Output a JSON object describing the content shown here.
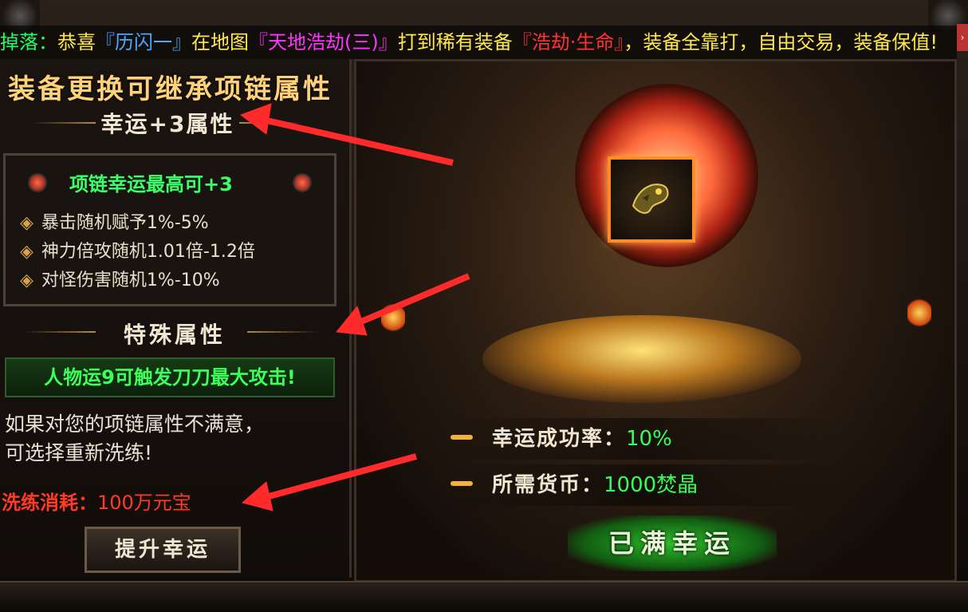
{
  "ticker": {
    "prefix": "掉落：",
    "congrats": "恭喜",
    "player": "『历闪一』",
    "at_map": "在地图",
    "map": "『天地浩劫(三)』",
    "got": "打到稀有装备",
    "item": "『浩劫·生命』",
    "suffix": "，装备全靠打，自由交易，装备保值!"
  },
  "left": {
    "headline": "装备更换可继承项链属性",
    "luck_title": "幸运+3属性",
    "box_title": "项链幸运最高可+3",
    "attributes": [
      "暴击随机赋予1%-5%",
      "神力倍攻随机1.01倍-1.2倍",
      "对怪伤害随机1%-10%"
    ],
    "special_title": "特殊属性",
    "special_banner": "人物运9可触发刀刀最大攻击!",
    "note_line1": "如果对您的项链属性不满意，",
    "note_line2": "可选择重新洗练!",
    "cost_label": "洗练消耗：",
    "cost_value": "100万元宝",
    "upgrade_button": "提升幸运"
  },
  "right": {
    "success_label": "幸运成功率：",
    "success_value": "10%",
    "currency_label": "所需货币：",
    "currency_value": "1000焚晶",
    "full_button": "已满幸运"
  },
  "colors": {
    "green_text": "#33ff55",
    "red_text": "#ff3b24",
    "gold_text": "#ffd27a",
    "arrow": "#ff2a2a"
  }
}
